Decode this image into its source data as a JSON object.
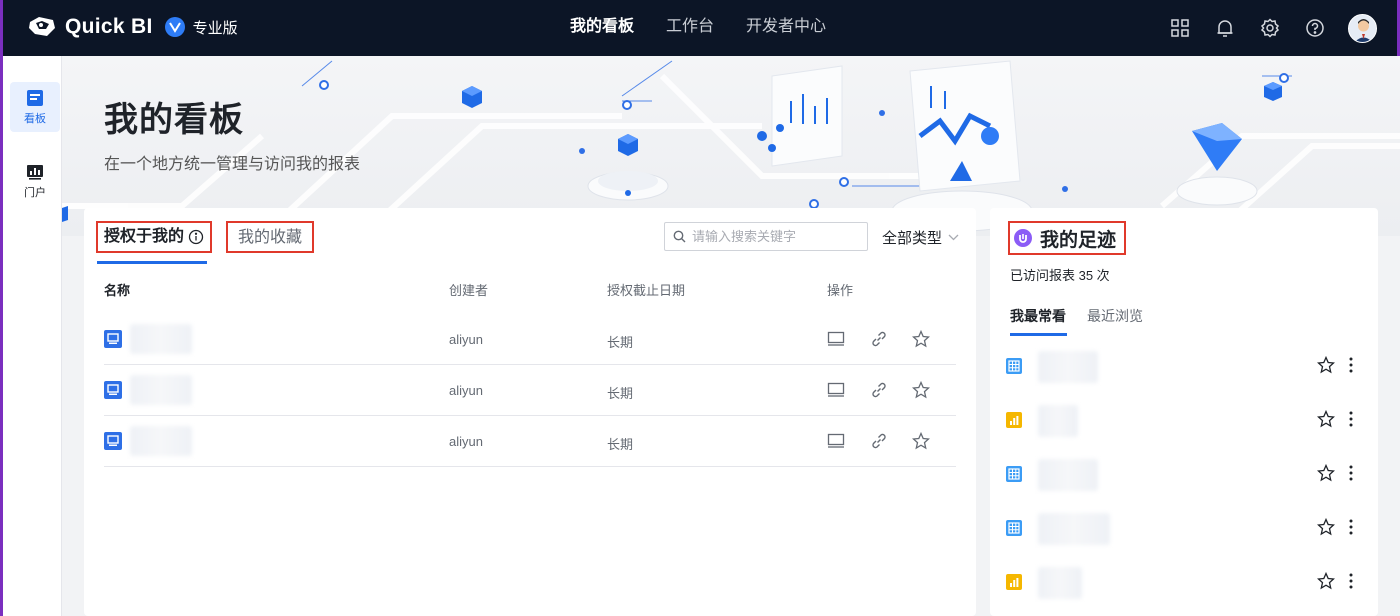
{
  "app": {
    "brand": "Quick BI",
    "edition": "专业版"
  },
  "nav": {
    "items": [
      "我的看板",
      "工作台",
      "开发者中心"
    ],
    "active_index": 0
  },
  "rail": {
    "items": [
      {
        "label": "看板",
        "icon": "dashboard-icon",
        "active": true
      },
      {
        "label": "门户",
        "icon": "portal-icon",
        "active": false
      }
    ]
  },
  "banner": {
    "title": "我的看板",
    "subtitle": "在一个地方统一管理与访问我的报表"
  },
  "main": {
    "tabs": [
      {
        "label": "授权于我的",
        "active": true,
        "info_icon": "info-icon"
      },
      {
        "label": "我的收藏",
        "active": false
      }
    ],
    "search": {
      "placeholder": "请输入搜索关键字",
      "value": ""
    },
    "filter": {
      "label": "全部类型"
    },
    "columns": [
      "名称",
      "创建者",
      "授权截止日期",
      "操作"
    ],
    "rows": [
      {
        "name": "",
        "creator": "aliyun",
        "expiry": "长期"
      },
      {
        "name": "",
        "creator": "aliyun",
        "expiry": "长期"
      },
      {
        "name": "",
        "creator": "aliyun",
        "expiry": "长期"
      }
    ],
    "row_actions": [
      "preview-icon",
      "link-icon",
      "star-icon"
    ]
  },
  "panel": {
    "title": "我的足迹",
    "visited": "已访问报表 35 次",
    "tabs": [
      "我最常看",
      "最近浏览"
    ],
    "active_tab": 0,
    "items": [
      {
        "type": "table",
        "color": "#3b9cf5"
      },
      {
        "type": "chart",
        "color": "#f5b700"
      },
      {
        "type": "table",
        "color": "#3b9cf5"
      },
      {
        "type": "table",
        "color": "#3b9cf5"
      },
      {
        "type": "chart",
        "color": "#f5b700"
      }
    ]
  },
  "colors": {
    "topbar": "#0c1526",
    "accent": "#1f6ae6",
    "highlight_box": "#e0392b"
  }
}
